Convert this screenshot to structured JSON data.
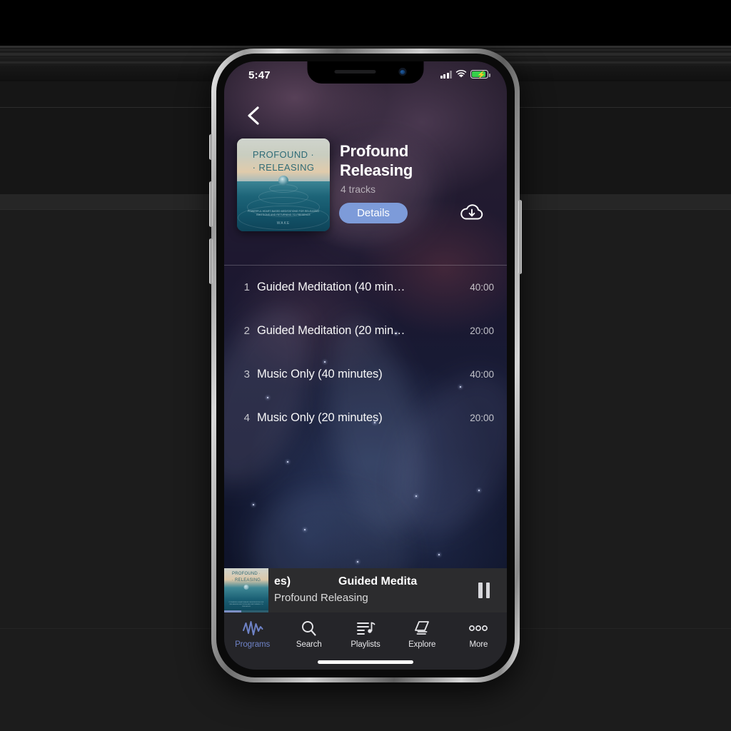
{
  "status_bar": {
    "time": "5:47",
    "battery_charging": true,
    "cellular_bars": 3,
    "wifi": true
  },
  "nav": {
    "back_icon": "chevron-left-icon"
  },
  "album": {
    "art_line1": "PROFOUND ·",
    "art_line2": "· RELEASING",
    "art_subtitle": "POWERFUL HEART-BASED MEDITATIONS FOR RELEASING EMOTIONS AND RETURNING TO PRESENCE",
    "art_brand": "WAKE",
    "title": "Profound Releasing",
    "track_count": "4 tracks",
    "details_label": "Details",
    "download_icon": "cloud-download-icon"
  },
  "tracks": [
    {
      "number": "1",
      "name": "Guided Meditation (40 min…",
      "duration": "40:00"
    },
    {
      "number": "2",
      "name": "Guided Meditation (20 min…",
      "duration": "20:00"
    },
    {
      "number": "3",
      "name": "Music Only (40 minutes)",
      "duration": "40:00"
    },
    {
      "number": "4",
      "name": "Music Only (20 minutes)",
      "duration": "20:00"
    }
  ],
  "mini_player": {
    "marquee_lead": "es)",
    "marquee_title": "Guided Medita",
    "artist": "Profound Releasing",
    "transport_icon": "pause-icon"
  },
  "tab_bar": {
    "active": "Programs",
    "items": [
      {
        "label": "Programs",
        "icon": "waveform-icon"
      },
      {
        "label": "Search",
        "icon": "search-icon"
      },
      {
        "label": "Playlists",
        "icon": "playlist-music-icon"
      },
      {
        "label": "Explore",
        "icon": "stacked-cards-icon"
      },
      {
        "label": "More",
        "icon": "ellipsis-icon"
      }
    ]
  },
  "colors": {
    "accent": "#6e82c6",
    "details_button": "#7d9bd9",
    "battery_green": "#35d04a",
    "tabbar_bg": "#252529",
    "mini_bg": "#2c2c2e"
  }
}
